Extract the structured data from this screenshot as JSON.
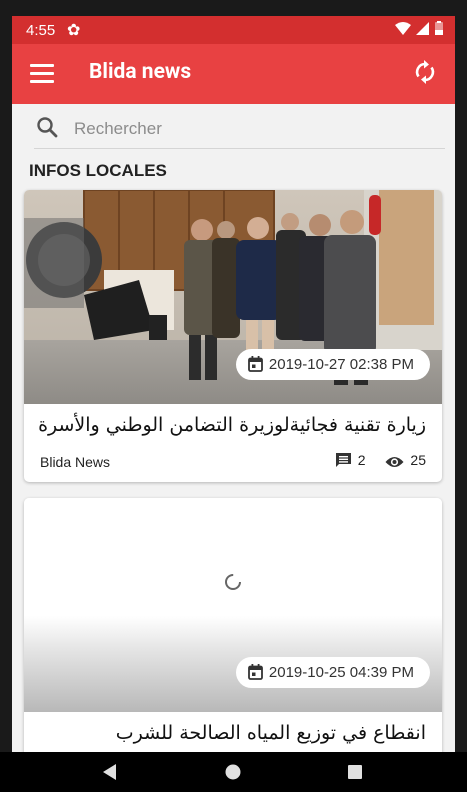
{
  "status_bar": {
    "time": "4:55"
  },
  "app_bar": {
    "title": "Blida news"
  },
  "search": {
    "placeholder": "Rechercher"
  },
  "section_title": "INFOS LOCALES",
  "articles": [
    {
      "date": "2019-10-27 02:38 PM",
      "title": "زيارة تقنية فجائيةلوزيرة التضامن الوطني والأسرة",
      "source": "Blida News",
      "comments": "2",
      "views": "25"
    },
    {
      "date": "2019-10-25 04:39 PM",
      "title": "انقطاع في توزيع المياه الصالحة للشرب"
    }
  ],
  "colors": {
    "app_bar": "#e84142",
    "status_bar": "#d32f2f"
  }
}
